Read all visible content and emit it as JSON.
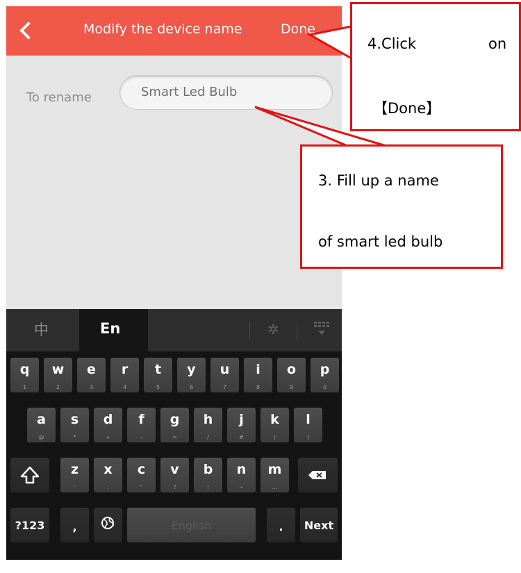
{
  "header": {
    "title": "Modify the device name",
    "done_label": "Done"
  },
  "form": {
    "label": "To rename",
    "input_value": "Smart Led Bulb"
  },
  "keyboard": {
    "lang_zh": "中",
    "lang_en": "En",
    "row1": [
      [
        "q",
        "1"
      ],
      [
        "w",
        "2"
      ],
      [
        "e",
        "3"
      ],
      [
        "r",
        "4"
      ],
      [
        "t",
        "5"
      ],
      [
        "y",
        "6"
      ],
      [
        "u",
        "7"
      ],
      [
        "i",
        "8"
      ],
      [
        "o",
        "9"
      ],
      [
        "p",
        "0"
      ]
    ],
    "row2": [
      [
        "a",
        "@"
      ],
      [
        "s",
        "*"
      ],
      [
        "d",
        "+"
      ],
      [
        "f",
        "-"
      ],
      [
        "g",
        "="
      ],
      [
        "h",
        "/"
      ],
      [
        "j",
        "#"
      ],
      [
        "k",
        "("
      ],
      [
        "l",
        ")"
      ]
    ],
    "row3": [
      [
        "z",
        "'"
      ],
      [
        "x",
        ":"
      ],
      [
        "c",
        "\""
      ],
      [
        "v",
        "?"
      ],
      [
        "b",
        "!"
      ],
      [
        "n",
        "~"
      ],
      [
        "m",
        "..."
      ]
    ],
    "symbols_label": "?123",
    "comma": ",",
    "space_label": "English",
    "period": ".",
    "next_label": "Next"
  },
  "annotations": {
    "done_step_line1": "4.Click",
    "done_step_line1b": "on",
    "done_step_line2": "【Done】",
    "name_step_line1": "3.  Fill  up  a  name",
    "name_step_line2": "of smart led bulb"
  },
  "colors": {
    "header": "#f0584a",
    "annotation_border": "#e31212",
    "keyboard": "#141414"
  }
}
